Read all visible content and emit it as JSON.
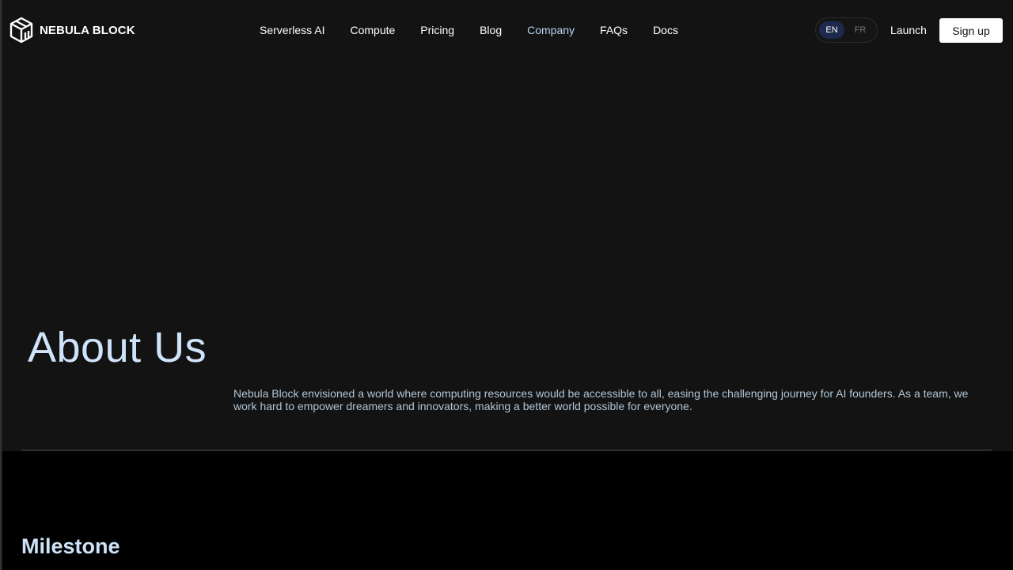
{
  "brand": {
    "name": "NEBULA BLOCK",
    "icon": "cube-logo-icon"
  },
  "nav": {
    "items": [
      {
        "label": "Serverless AI",
        "active": false
      },
      {
        "label": "Compute",
        "active": false
      },
      {
        "label": "Pricing",
        "active": false
      },
      {
        "label": "Blog",
        "active": false
      },
      {
        "label": "Company",
        "active": true
      },
      {
        "label": "FAQs",
        "active": false
      },
      {
        "label": "Docs",
        "active": false
      }
    ]
  },
  "language": {
    "options": [
      "EN",
      "FR"
    ],
    "selected": "EN"
  },
  "actions": {
    "launch_label": "Launch",
    "signup_label": "Sign up"
  },
  "hero": {
    "title": "About Us",
    "description": "Nebula Block envisioned a world where computing resources would be accessible to all, easing the challenging journey for AI founders. As a team, we work hard to empower dreamers and innovators, making a better world possible for everyone."
  },
  "milestone": {
    "title": "Milestone"
  },
  "colors": {
    "background": "#131313",
    "accent_heading": "#cfe4fa",
    "active_nav": "#b8d4f0",
    "lang_selected": "#1d2a4d"
  }
}
